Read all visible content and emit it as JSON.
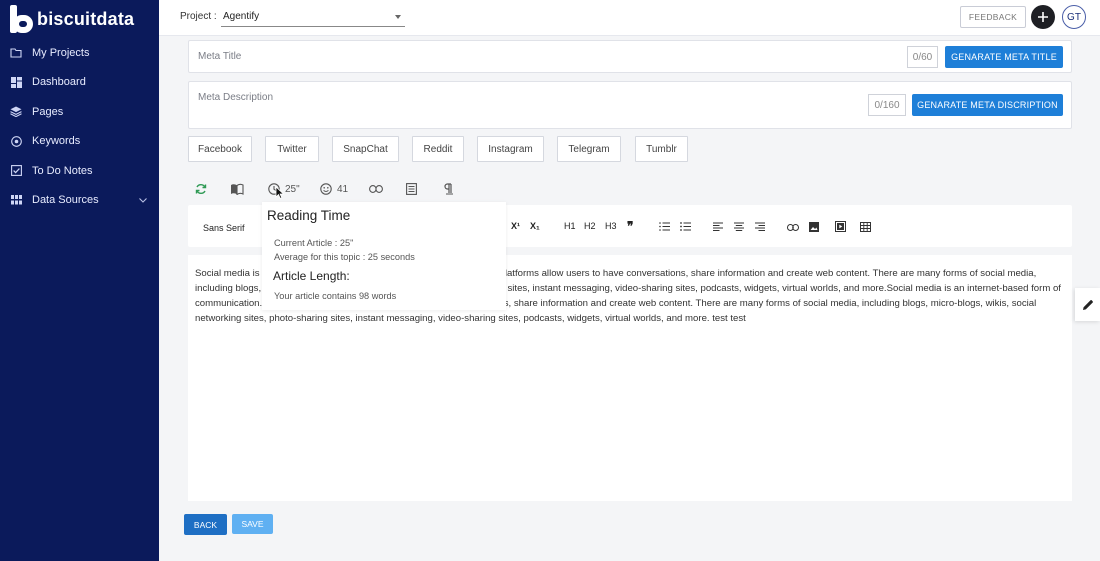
{
  "brand": {
    "name": "biscuitdata"
  },
  "sidebar": {
    "items": [
      {
        "label": "My Projects",
        "icon": "folder-icon"
      },
      {
        "label": "Dashboard",
        "icon": "dashboard-icon"
      },
      {
        "label": "Pages",
        "icon": "layers-icon"
      },
      {
        "label": "Keywords",
        "icon": "target-icon"
      },
      {
        "label": "To Do Notes",
        "icon": "checkbox-icon"
      },
      {
        "label": "Data Sources",
        "icon": "grid-icon",
        "expandable": true
      }
    ]
  },
  "topbar": {
    "project_label": "Project :",
    "project_value": "Agentify",
    "feedback": "FEEDBACK",
    "avatar_initials": "GT"
  },
  "meta": {
    "title_placeholder": "Meta Title",
    "title_counter": "0/60",
    "title_button": "GENARATE META TITLE",
    "desc_placeholder": "Meta Description",
    "desc_counter": "0/160",
    "desc_button": "GENARATE META DISCRIPTION"
  },
  "social": [
    "Facebook",
    "Twitter",
    "SnapChat",
    "Reddit",
    "Instagram",
    "Telegram",
    "Tumblr"
  ],
  "stats": {
    "reading_time": "25\"",
    "sentiment_score": "41"
  },
  "toolbar": {
    "font": "Sans Serif",
    "buttons": [
      "X¹",
      "X₁",
      "H1",
      "H2",
      "H3",
      "❞"
    ]
  },
  "tooltip": {
    "title": "Reading Time",
    "current": "Current Article : 25\"",
    "average": "Average for this topic : 25 seconds",
    "length_title": "Article Length:",
    "length_text": "Your article contains 98 words"
  },
  "editor": {
    "content": "Social media is an internet-based form of communication. Social media platforms allow users to have conversations, share information and create web content. There are many forms of social media, including blogs, micro-blogs, wikis, social networking sites, photo-sharing sites, instant messaging, video-sharing sites, podcasts, widgets, virtual worlds, and more.Social media is an internet-based form of communication. Social media platforms allow users to have conversations, share information and create web content. There are many forms of social media, including blogs, micro-blogs, wikis, social networking sites, photo-sharing sites, instant messaging, video-sharing sites, podcasts, widgets, virtual worlds, and more.  test test"
  },
  "actions": {
    "back": "BACK",
    "save": "SAVE"
  },
  "colors": {
    "sidebar": "#0b1a5b",
    "primary": "#1e7fd8",
    "save_disabled": "#5fb0f2"
  }
}
